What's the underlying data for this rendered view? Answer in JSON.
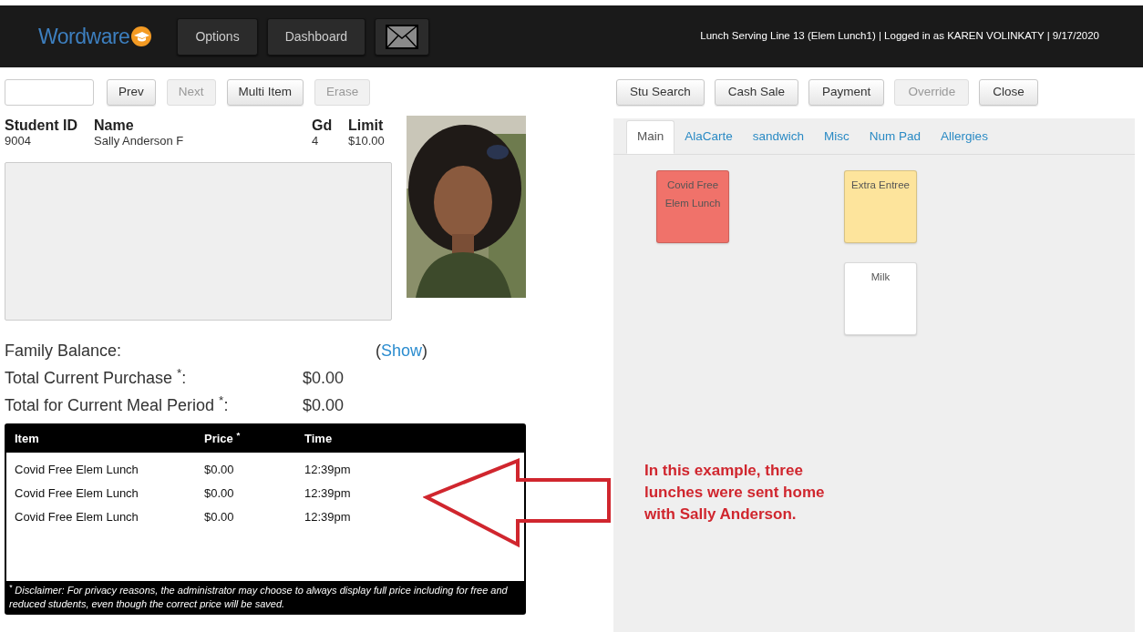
{
  "header": {
    "logo": "Wordware",
    "nav_buttons": [
      {
        "kind": "text",
        "label": "Options"
      },
      {
        "kind": "text",
        "label": "Dashboard"
      },
      {
        "kind": "mail"
      }
    ],
    "session_info": "Lunch Serving Line 13 (Elem Lunch1) | Logged in as KAREN VOLINKATY | 9/17/2020"
  },
  "left_toolbar": {
    "buttons": [
      {
        "label": "Prev",
        "disabled": false
      },
      {
        "label": "Next",
        "disabled": true
      },
      {
        "label": "Multi Item",
        "disabled": false
      },
      {
        "label": "Erase",
        "disabled": true
      }
    ]
  },
  "right_toolbar": {
    "buttons": [
      {
        "label": "Stu Search",
        "disabled": false
      },
      {
        "label": "Cash Sale",
        "disabled": false
      },
      {
        "label": "Payment",
        "disabled": false
      },
      {
        "label": "Override",
        "disabled": true
      },
      {
        "label": "Close",
        "disabled": false
      }
    ]
  },
  "student": {
    "columns": [
      "Student ID",
      "Name",
      "Gd",
      "Limit"
    ],
    "values": [
      "9004",
      "Sally Anderson F",
      "4",
      "$10.00"
    ],
    "photo": {
      "kind": "picture"
    }
  },
  "family_balance": {
    "label": "Family Balance:",
    "open_paren": "(",
    "link": "Show",
    "close_paren": ")"
  },
  "totals": [
    {
      "label": "Total Current Purchase $^{*}$:",
      "value": "$0.00"
    },
    {
      "label": "Total for Current Meal Period $^{*}$:",
      "value": "$0.00"
    }
  ],
  "purchases": {
    "columns": [
      "Item",
      "Price $^{*}$",
      "Time"
    ],
    "rows": [
      [
        "Covid Free Elem Lunch",
        "$0.00",
        "12:39pm"
      ],
      [
        "Covid Free Elem Lunch",
        "$0.00",
        "12:39pm"
      ],
      [
        "Covid Free Elem Lunch",
        "$0.00",
        "12:39pm"
      ]
    ],
    "disclaimer": "$^{*}$ Disclaimer: For privacy reasons, the administrator may choose to always display full price including for free and reduced students, even though the correct price will be saved."
  },
  "menu_tabs": [
    {
      "label": "Main",
      "selected": true
    },
    {
      "label": "AlaCarte",
      "selected": false
    },
    {
      "label": "sandwich",
      "selected": false
    },
    {
      "label": "Misc",
      "selected": false
    },
    {
      "label": "Num Pad",
      "selected": false
    },
    {
      "label": "Allergies",
      "selected": false
    }
  ],
  "menu_tile_rows": [
    [
      {
        "kind": "item",
        "label": "Covid Free Elem Lunch",
        "color": "#f0726a"
      },
      {
        "kind": "blank"
      },
      {
        "kind": "item",
        "label": "Extra Entree",
        "color": "#fde49c"
      }
    ],
    [
      {
        "kind": "blank"
      },
      {
        "kind": "blank"
      },
      {
        "kind": "item",
        "label": "Milk",
        "color": "#ffffff"
      }
    ]
  ],
  "annotation": {
    "lines": [
      "In this example, three",
      "lunches were sent home",
      "with Sally Anderson."
    ]
  }
}
